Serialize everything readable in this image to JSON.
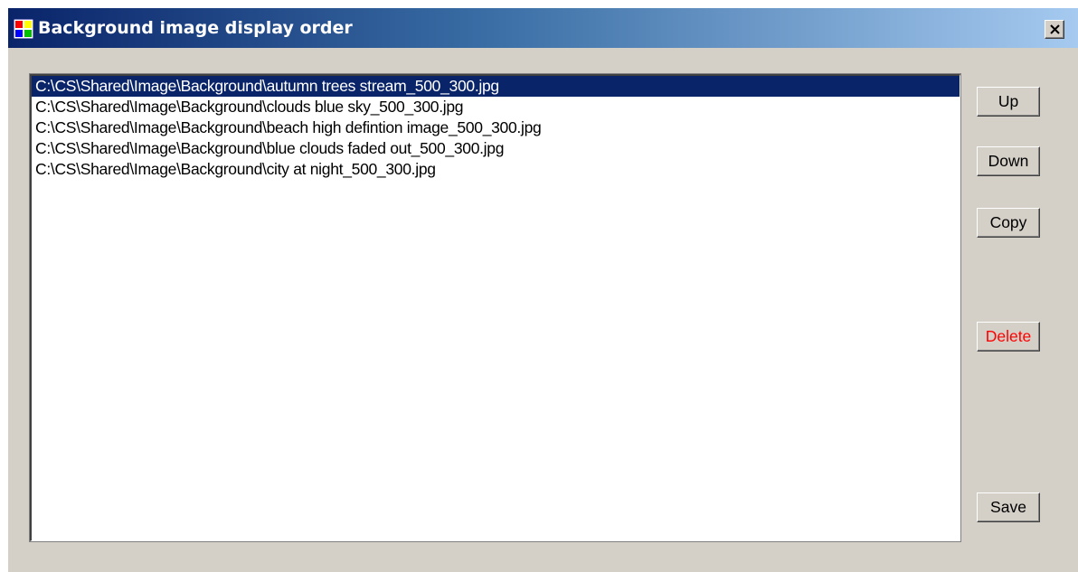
{
  "window": {
    "title": "Background image display order",
    "close_glyph": "✕"
  },
  "list": {
    "items": [
      "C:\\CS\\Shared\\Image\\Background\\autumn trees stream_500_300.jpg",
      "C:\\CS\\Shared\\Image\\Background\\clouds blue sky_500_300.jpg",
      "C:\\CS\\Shared\\Image\\Background\\beach high defintion image_500_300.jpg",
      "C:\\CS\\Shared\\Image\\Background\\blue clouds faded out_500_300.jpg",
      "C:\\CS\\Shared\\Image\\Background\\city at night_500_300.jpg"
    ],
    "selected_index": 0
  },
  "buttons": {
    "up": "Up",
    "down": "Down",
    "copy": "Copy",
    "delete": "Delete",
    "save": "Save"
  },
  "colors": {
    "title_gradient_start": "#0a246a",
    "title_gradient_end": "#a6caf0",
    "selection": "#0a246a",
    "delete_text": "#ff0000",
    "face": "#d4d0c8"
  },
  "icons": {
    "app": "app-window-icon",
    "close": "close-icon"
  }
}
